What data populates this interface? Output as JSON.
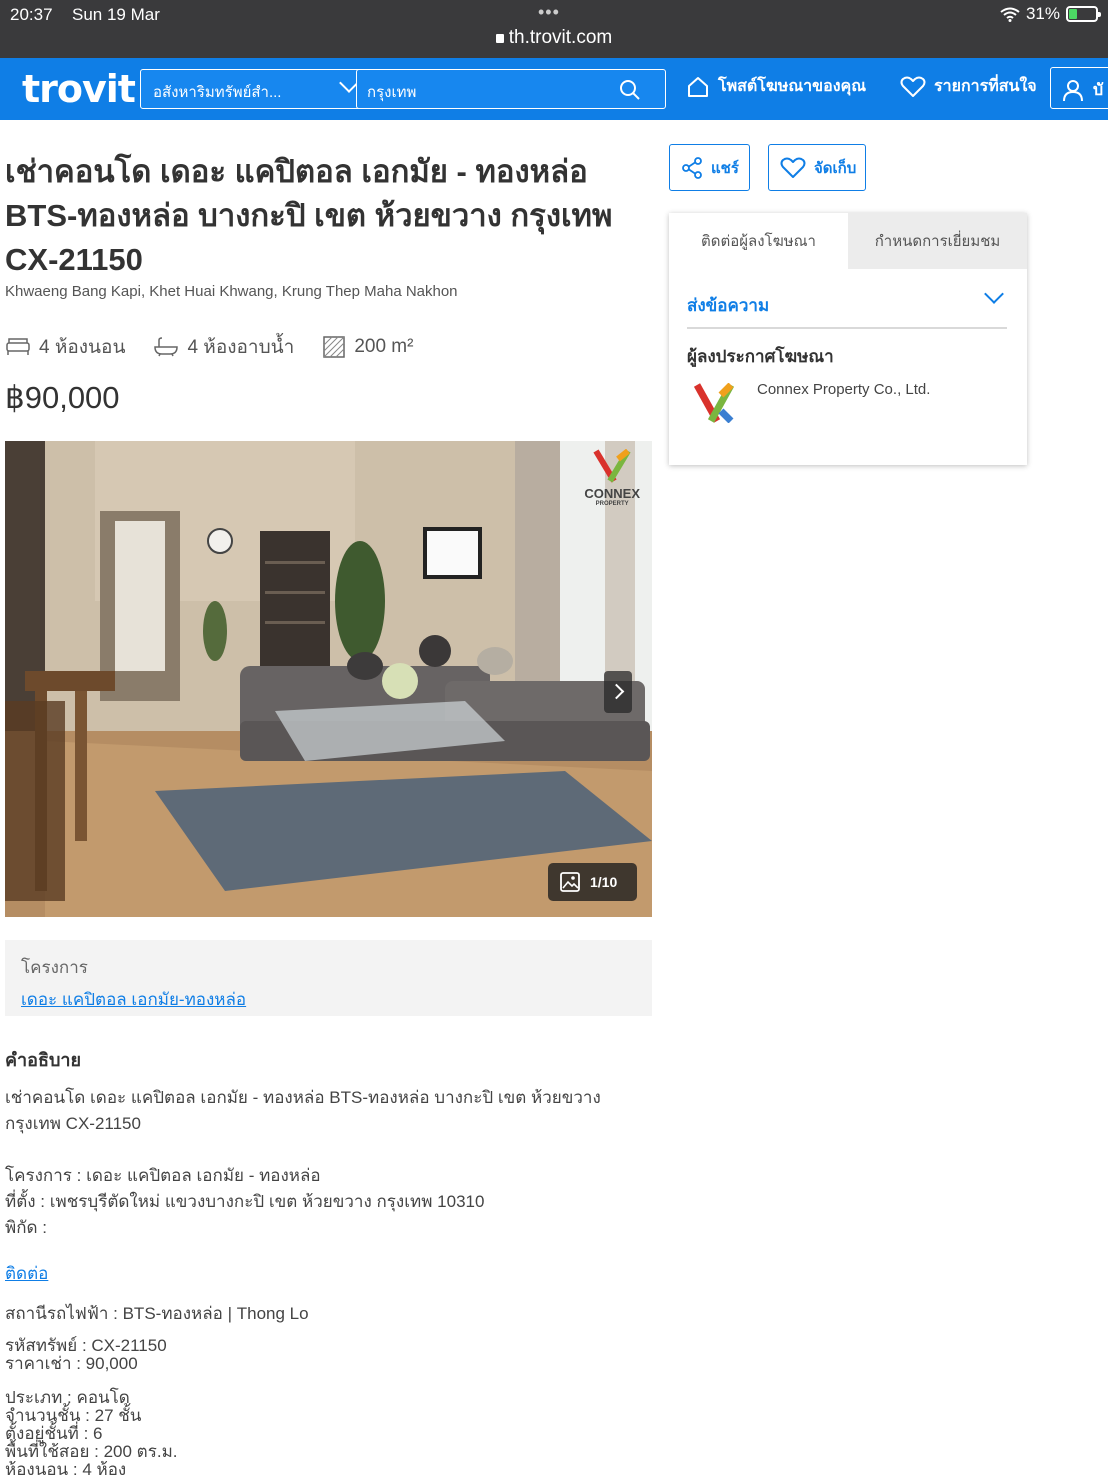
{
  "status_bar": {
    "time": "20:37",
    "date": "Sun 19 Mar",
    "url": "th.trovit.com",
    "battery": "31%",
    "battery_level": 0.31
  },
  "header": {
    "logo": "trovit",
    "category_select": "อสังหาริมทรัพย์สำ...",
    "search_value": "กรุงเทพ",
    "post_ad": "โพสต์โฆษณาของคุณ",
    "favorites": "รายการที่สนใจ",
    "account": "บั"
  },
  "listing": {
    "title": "เช่าคอนโด เดอะ แคปิตอล เอกมัย - ทองหล่อ BTS-ทองหล่อ บางกะปิ เขต ห้วยขวาง กรุงเทพ CX-21150",
    "address": "Khwaeng Bang Kapi, Khet Huai Khwang, Krung Thep Maha Nakhon",
    "bedrooms": "4 ห้องนอน",
    "bathrooms": "4 ห้องอาบน้ำ",
    "area": "200 m²",
    "price": "฿90,000"
  },
  "gallery": {
    "watermark": "CONNEX",
    "watermark_sub": "PROPERTY",
    "counter": "1/10"
  },
  "project": {
    "label": "โครงการ",
    "link": "เดอะ แคปิตอล เอกมัย-ทองหล่อ"
  },
  "description": {
    "heading": "คำอธิบาย",
    "intro": "เช่าคอนโด เดอะ แคปิตอล เอกมัย - ทองหล่อ BTS-ทองหล่อ บางกะปิ เขต ห้วยขวาง กรุงเทพ CX-21150",
    "project_line": "โครงการ : เดอะ แคปิตอล เอกมัย - ทองหล่อ",
    "location_line": "ที่ตั้ง : เพชรบุรีตัดใหม่ แขวงบางกะปิ เขต ห้วยขวาง กรุงเทพ 10310",
    "coords_line": "พิกัด :",
    "contact_link": "ติดต่อ",
    "station_line": "สถานีรถไฟฟ้า : BTS-ทองหล่อ | Thong Lo",
    "code_line": "รหัสทรัพย์ : CX-21150",
    "rent_line": "ราคาเช่า : 90,000",
    "type_line": "ประเภท : คอนโด",
    "floors_line": "จำนวนชั้น : 27 ชั้น",
    "floor_line": "ตั้งอยู่ชั้นที่ : 6",
    "area_line": "พื้นที่ใช้สอย : 200 ตร.ม.",
    "rooms_line": "ห้องนอน : 4 ห้อง"
  },
  "actions": {
    "share": "แชร์",
    "save": "จัดเก็บ"
  },
  "contact_panel": {
    "tab_contact": "ติดต่อผู้ลงโฆษณา",
    "tab_visit": "กำหนดการเยี่ยมชม",
    "send_message": "ส่งข้อความ",
    "advertiser_heading": "ผู้ลงประกาศโฆษณา",
    "advertiser_name": "Connex Property Co., Ltd."
  }
}
